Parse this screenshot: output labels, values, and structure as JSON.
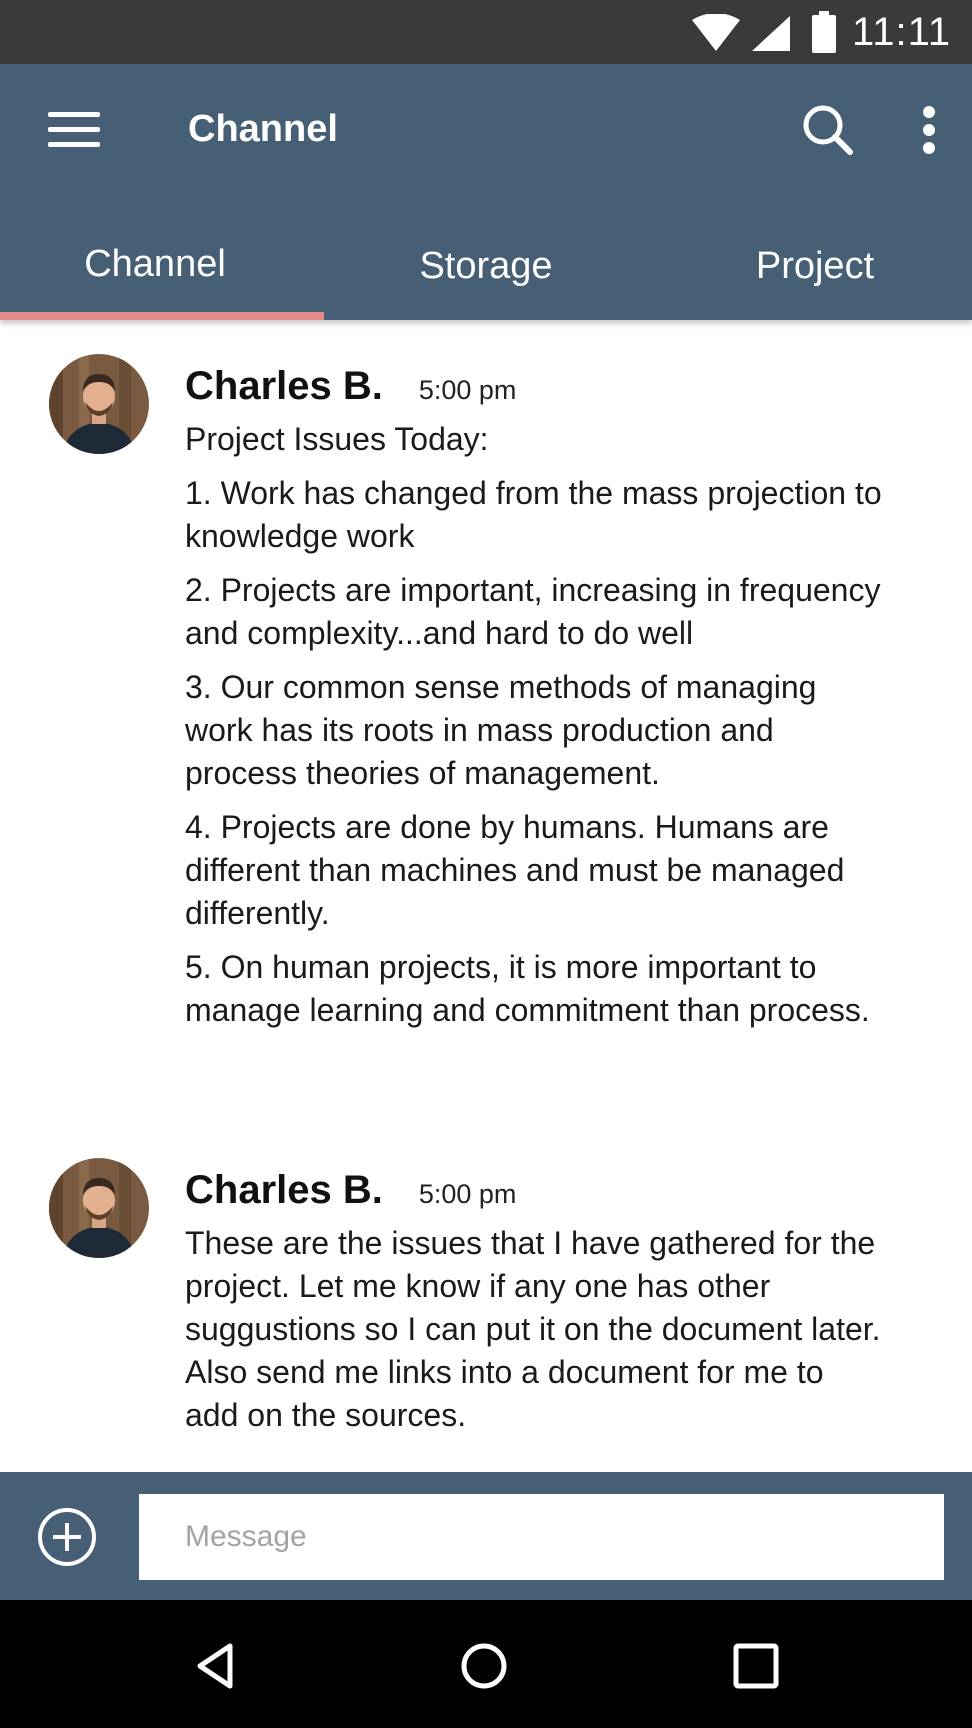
{
  "status_bar": {
    "time": "11:11",
    "icons": [
      "wifi-icon",
      "signal-icon",
      "battery-icon"
    ]
  },
  "app_bar": {
    "title": "Channel",
    "menu_icon": "menu-icon",
    "search_icon": "search-icon",
    "more_icon": "more-vertical-icon"
  },
  "tabs": [
    {
      "label": "Channel",
      "active": true
    },
    {
      "label": "Storage",
      "active": false
    },
    {
      "label": "Project",
      "active": false
    }
  ],
  "colors": {
    "status_bar": "#3a3a3a",
    "primary": "#465f75",
    "tab_indicator": "#e58a8a",
    "nav_bar": "#000000"
  },
  "messages": [
    {
      "sender": "Charles B.",
      "time": "5:00 pm",
      "lines": [
        "Project Issues Today:",
        "1. Work has changed from the mass projection to knowledge work",
        "2. Projects are important, increasing in frequency and complexity...and hard to do well",
        "3. Our common sense methods of managing work has its roots in mass production and process theories of management.",
        "4. Projects are done by humans. Humans are different than machines and must be managed differently.",
        "5. On human projects, it is more important to manage learning and commitment than process."
      ]
    },
    {
      "sender": "Charles B.",
      "time": "5:00 pm",
      "lines": [
        "These are the issues that I have gathered for the project. Let me know if any one has other suggustions so I can put it on the document later. Also send me links into a document for me to add on the sources."
      ]
    }
  ],
  "composer": {
    "add_icon": "add-circle-icon",
    "placeholder": "Message",
    "value": ""
  },
  "nav_bar": {
    "icons": [
      "back-icon",
      "home-icon",
      "recent-apps-icon"
    ]
  }
}
